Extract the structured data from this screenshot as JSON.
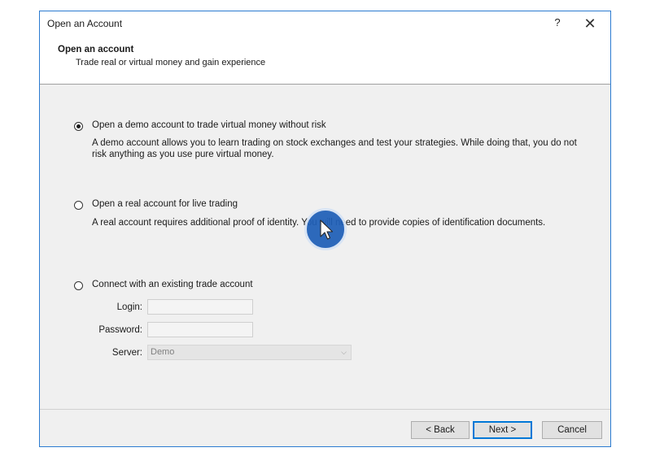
{
  "window": {
    "title": "Open an Account",
    "help_label": "?",
    "close_label": "✕"
  },
  "header": {
    "title": "Open an account",
    "subtitle": "Trade real or virtual money and gain experience"
  },
  "options": {
    "demo": {
      "label": "Open a demo account to trade virtual money without risk",
      "desc_line1": "A demo account allows you to learn trading on stock exchanges and test your strategies. While doing that, you do not",
      "desc_line2": "risk anything as you use pure virtual money.",
      "selected": true
    },
    "real": {
      "label": "Open a real account for live trading",
      "desc": "A real account requires additional proof of identity. You will need to provide copies of identification documents.",
      "selected": false
    },
    "existing": {
      "label": "Connect with an existing trade account",
      "selected": false,
      "login_label": "Login:",
      "login_value": "",
      "password_label": "Password:",
      "password_value": "",
      "server_label": "Server:",
      "server_value": "Demo"
    }
  },
  "footer": {
    "back_label": "< Back",
    "next_label": "Next >",
    "cancel_label": "Cancel"
  },
  "colors": {
    "accent": "#0078d7",
    "window_border": "#2b7bd1",
    "cursor_badge": "#1f5fb8"
  },
  "icons": {
    "help": "question-mark-icon",
    "close": "close-icon",
    "dropdown": "chevron-down-icon",
    "cursor": "pointer-cursor-icon"
  }
}
